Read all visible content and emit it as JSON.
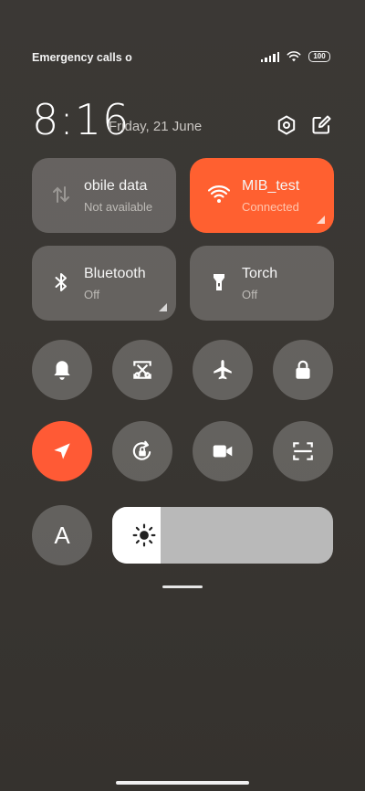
{
  "status_bar": {
    "carrier_text": "Emergency calls o",
    "battery": "100"
  },
  "header": {
    "time": "8:16",
    "date": "Friday, 21 June"
  },
  "tiles": [
    {
      "title": "obile data",
      "subtitle": "Not available",
      "icon": "mobile-data-icon",
      "active": false
    },
    {
      "title": "MIB_test",
      "subtitle": "Connected",
      "icon": "wifi-icon",
      "active": true
    },
    {
      "title": "Bluetooth",
      "subtitle": "Off",
      "icon": "bluetooth-icon",
      "active": false
    },
    {
      "title": "Torch",
      "subtitle": "Off",
      "icon": "torch-icon",
      "active": false
    }
  ],
  "toggles": [
    {
      "name": "bell-icon",
      "active": false
    },
    {
      "name": "screenshot-icon",
      "active": false
    },
    {
      "name": "airplane-icon",
      "active": false
    },
    {
      "name": "lock-icon",
      "active": false
    },
    {
      "name": "location-icon",
      "active": true
    },
    {
      "name": "rotation-lock-icon",
      "active": false
    },
    {
      "name": "video-camera-icon",
      "active": false
    },
    {
      "name": "scanner-icon",
      "active": false
    }
  ],
  "font_button": {
    "label": "A"
  },
  "brightness": {
    "level": 0.22
  },
  "colors": {
    "accent": "#ff6030",
    "tile_bg": "#5e5b58",
    "background": "#3a3733"
  }
}
